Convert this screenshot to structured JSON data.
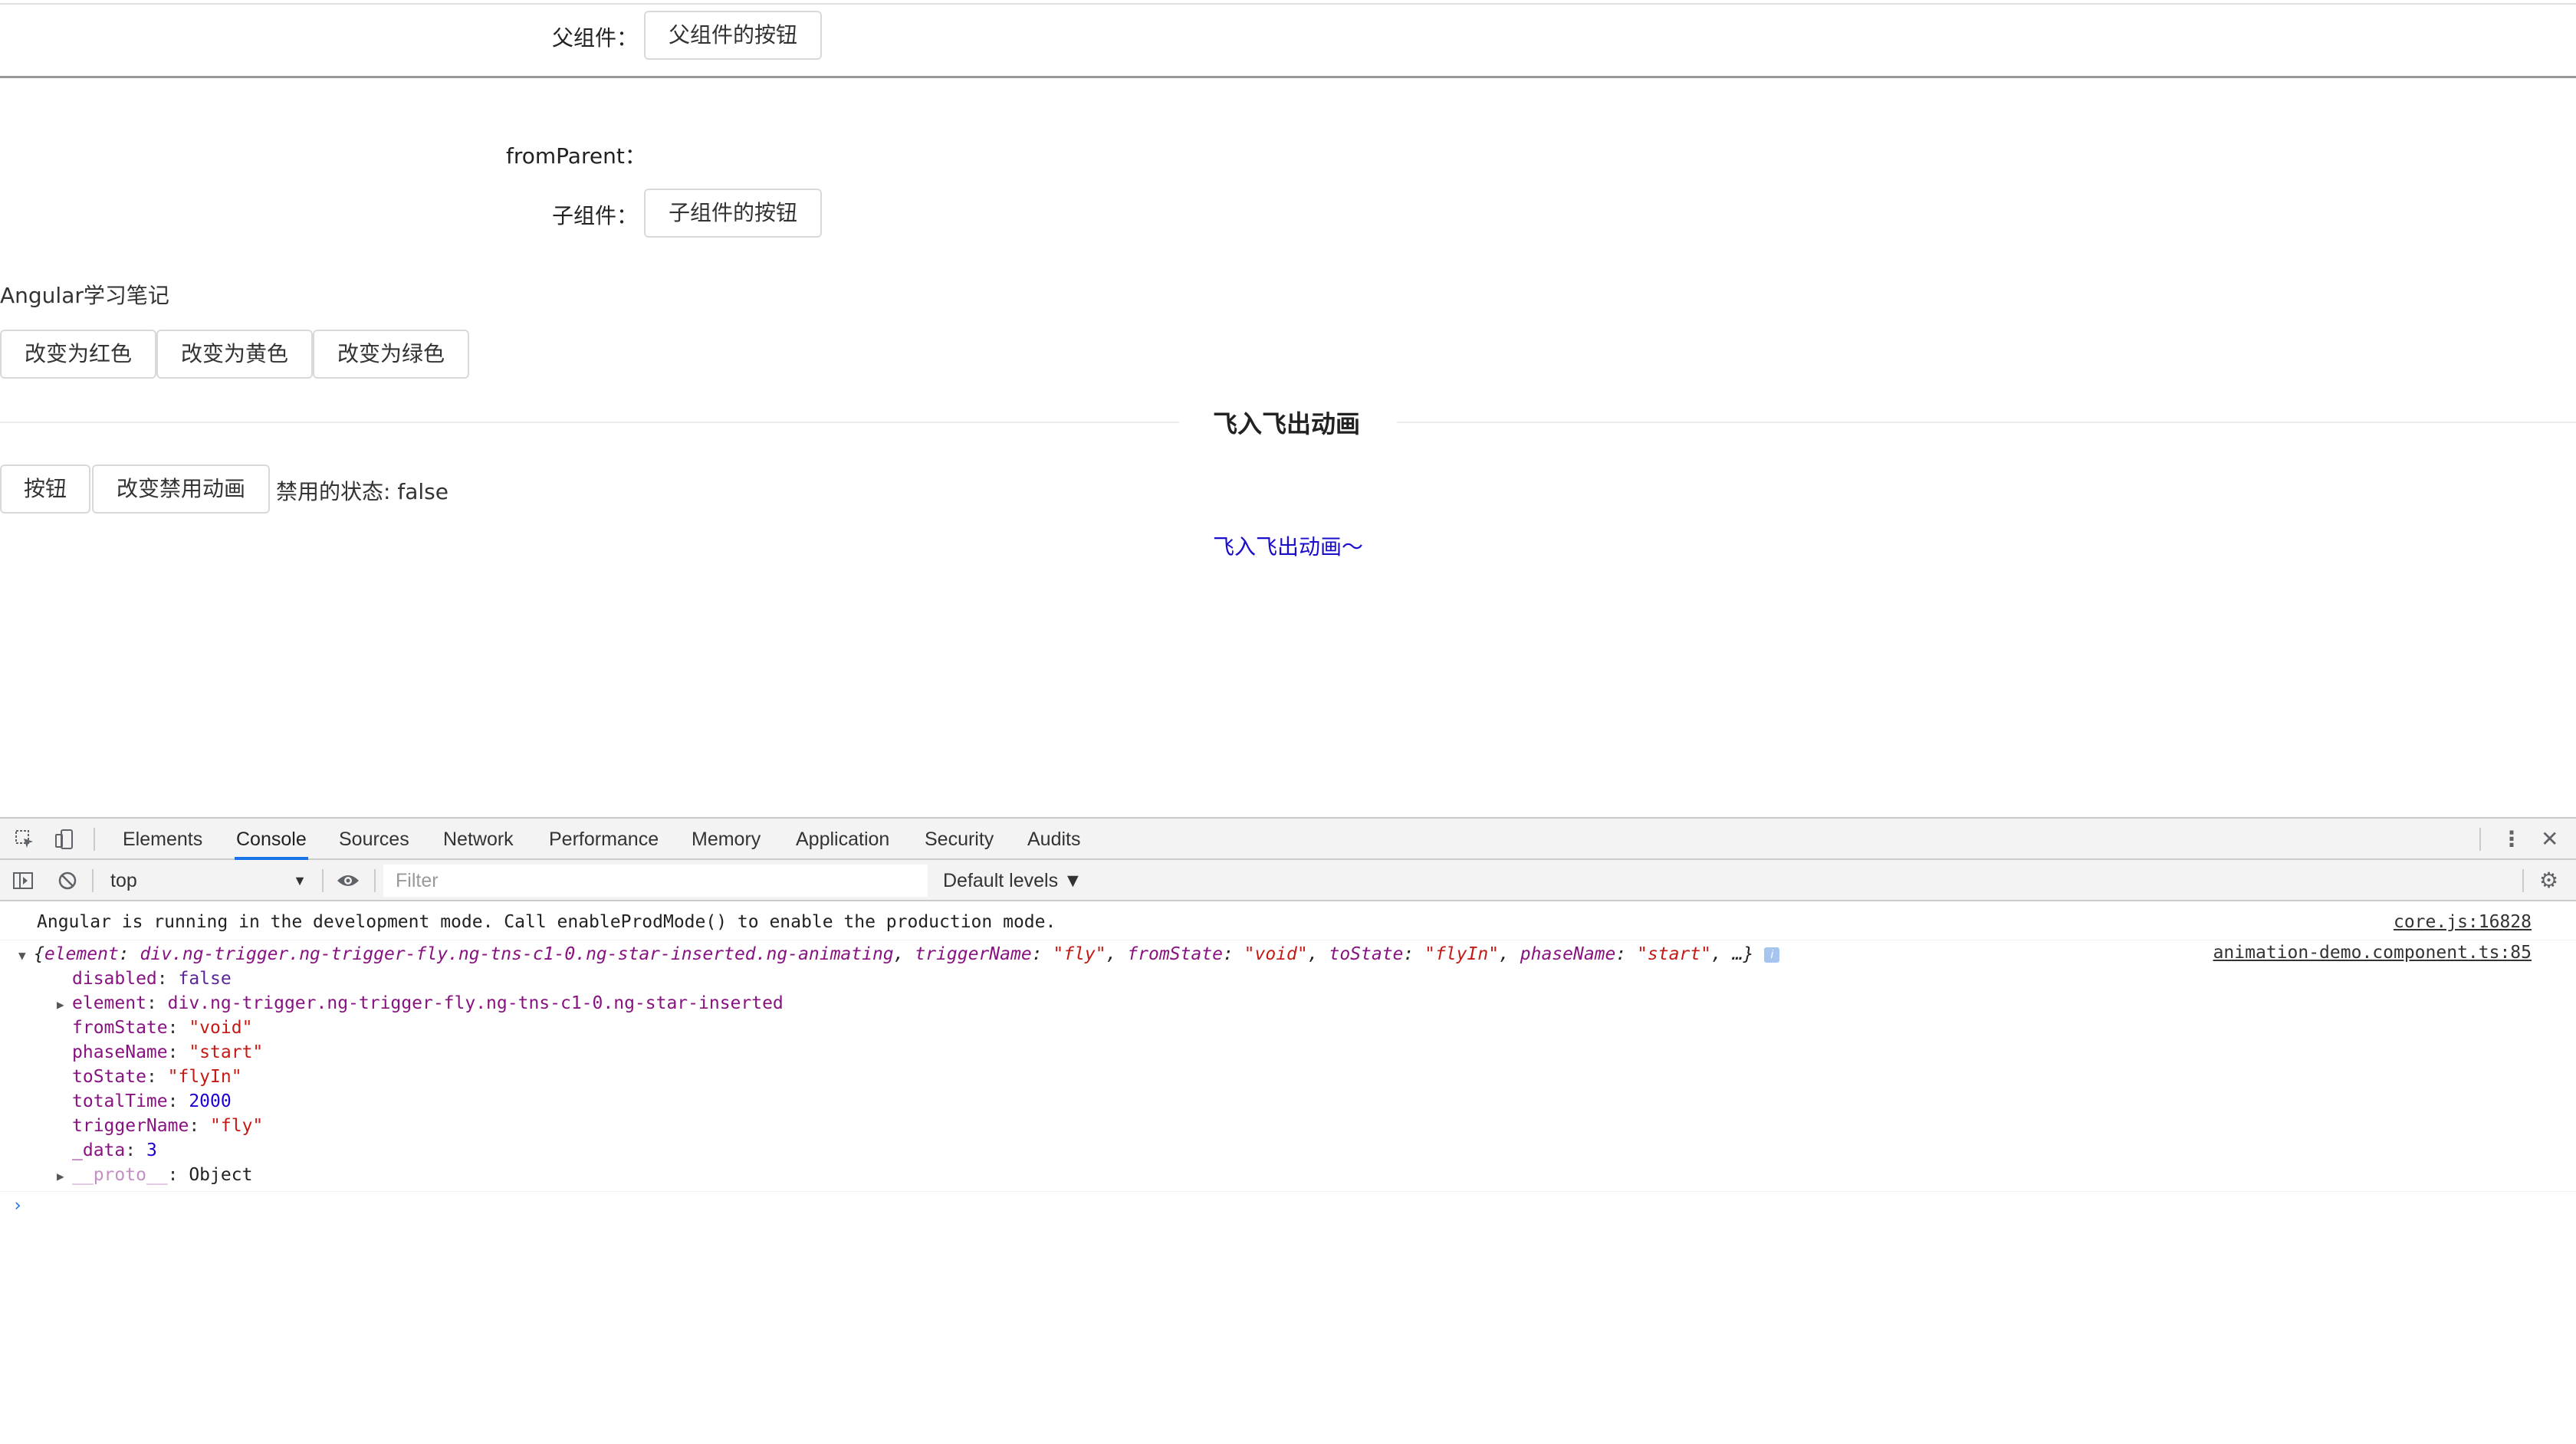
{
  "parent": {
    "label": "父组件：",
    "button": "父组件的按钮"
  },
  "child": {
    "from_parent_label": "fromParent：",
    "label": "子组件：",
    "button": "子组件的按钮"
  },
  "notes_title": "Angular学习笔记",
  "color_buttons": [
    "改变为红色",
    "改变为黄色",
    "改变为绿色"
  ],
  "section_title": "飞入飞出动画",
  "anim_controls": {
    "button": "按钮",
    "toggle_button": "改变禁用动画",
    "status_label": "禁用的状态: ",
    "status_value": "false"
  },
  "animated_text": "飞入飞出动画～",
  "devtools": {
    "tabs": [
      "Elements",
      "Console",
      "Sources",
      "Network",
      "Performance",
      "Memory",
      "Application",
      "Security",
      "Audits"
    ],
    "active_tab": "Console",
    "context": "top",
    "filter_placeholder": "Filter",
    "levels": "Default levels ▼",
    "log1": {
      "text": "Angular is running in the development mode. Call enableProdMode() to enable the production mode.",
      "source": "core.js:16828"
    },
    "log2": {
      "summary_open": "{",
      "summary_k1": "element",
      "summary_v1": "div.ng-trigger.ng-trigger-fly.ng-tns-c1-0.ng-star-inserted.ng-animating",
      "summary_k2": "triggerName",
      "summary_v2": "\"fly\"",
      "summary_k3": "fromState",
      "summary_v3": "\"void\"",
      "summary_k4": "toState",
      "summary_v4": "\"flyIn\"",
      "summary_k5": "phaseName",
      "summary_v5": "\"start\"",
      "summary_tail": ", …}",
      "source": "animation-demo.component.ts:85",
      "props": {
        "disabled_k": "disabled",
        "disabled_v": "false",
        "element_k": "element",
        "element_v": "div.ng-trigger.ng-trigger-fly.ng-tns-c1-0.ng-star-inserted",
        "fromState_k": "fromState",
        "fromState_v": "\"void\"",
        "phaseName_k": "phaseName",
        "phaseName_v": "\"start\"",
        "toState_k": "toState",
        "toState_v": "\"flyIn\"",
        "totalTime_k": "totalTime",
        "totalTime_v": "2000",
        "triggerName_k": "triggerName",
        "triggerName_v": "\"fly\"",
        "data_k": "_data",
        "data_v": "3",
        "proto_k": "__proto__",
        "proto_v": "Object"
      }
    },
    "prompt": "›"
  }
}
